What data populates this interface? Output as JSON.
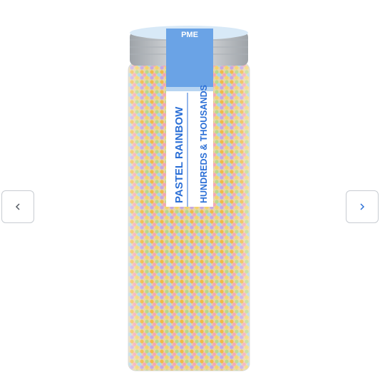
{
  "gallery": {
    "prev_icon": "chevron-left-icon",
    "next_icon": "chevron-right-icon",
    "accent": "#2b6fd6",
    "border": "#c8ccd2"
  },
  "product": {
    "brand": "PME",
    "name_line1": "PASTEL RAINBOW",
    "name_line2": "HUNDREDS & THOUSANDS",
    "label_color": "#6aa3e6",
    "cap_color": "#bfc3c8"
  }
}
